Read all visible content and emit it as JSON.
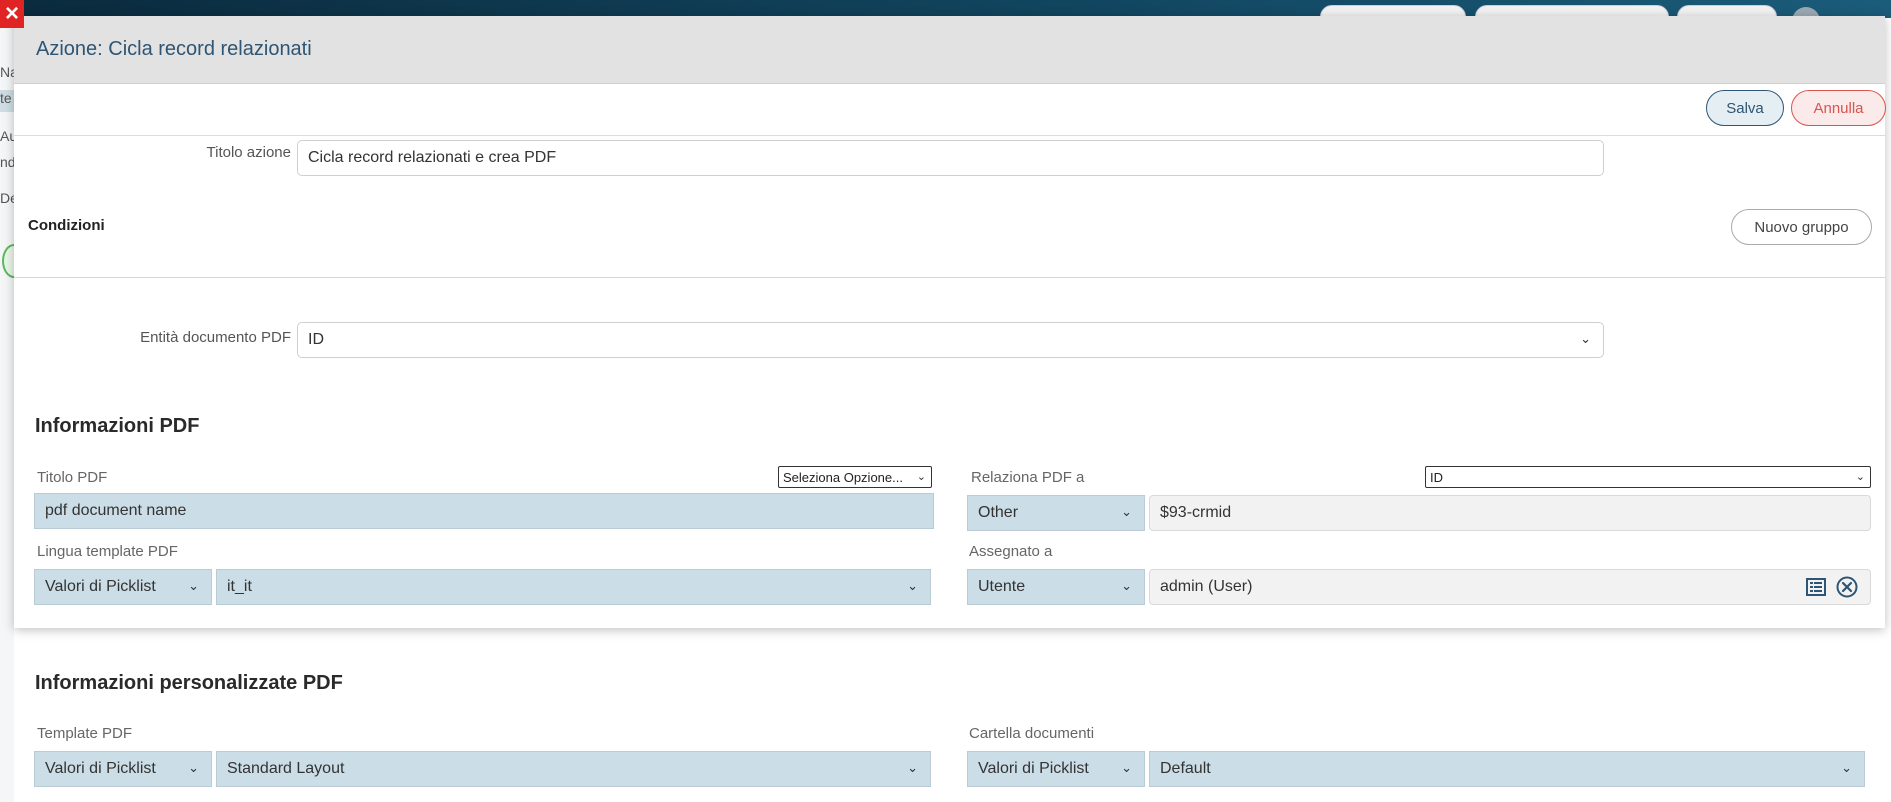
{
  "modal": {
    "title": "Azione: Cicla record relazionati",
    "save_label": "Salva",
    "cancel_label": "Annulla"
  },
  "form": {
    "action_title_label": "Titolo azione",
    "action_title_value": "Cicla record relazionati e crea PDF",
    "conditions_label": "Condizioni",
    "new_group_label": "Nuovo gruppo",
    "pdf_entity_label": "Entità documento PDF",
    "pdf_entity_value": "ID"
  },
  "pdf_info": {
    "heading": "Informazioni PDF",
    "title_label": "Titolo PDF",
    "title_option": "Seleziona Opzione...",
    "title_value": "pdf document name",
    "relate_label": "Relaziona PDF a",
    "relate_option": "ID",
    "relate_type": "Other",
    "relate_value": "$93-crmid",
    "language_label": "Lingua template PDF",
    "language_type": "Valori di Picklist",
    "language_value": "it_it",
    "assigned_label": "Assegnato a",
    "assigned_type": "Utente",
    "assigned_value": "admin (User)"
  },
  "custom_info": {
    "heading": "Informazioni personalizzate PDF",
    "template_label": "Template PDF",
    "template_type": "Valori di Picklist",
    "template_value": "Standard Layout",
    "folder_label": "Cartella documenti",
    "folder_type": "Valori di Picklist",
    "folder_value": "Default"
  },
  "background": {
    "frag_1": "Na",
    "frag_2": "te",
    "frag_3": "Au",
    "frag_4": "nd",
    "frag_5": "De"
  },
  "colors": {
    "accent": "#2e5573",
    "cancel": "#d9534f",
    "field_blue": "#cbdde6"
  }
}
